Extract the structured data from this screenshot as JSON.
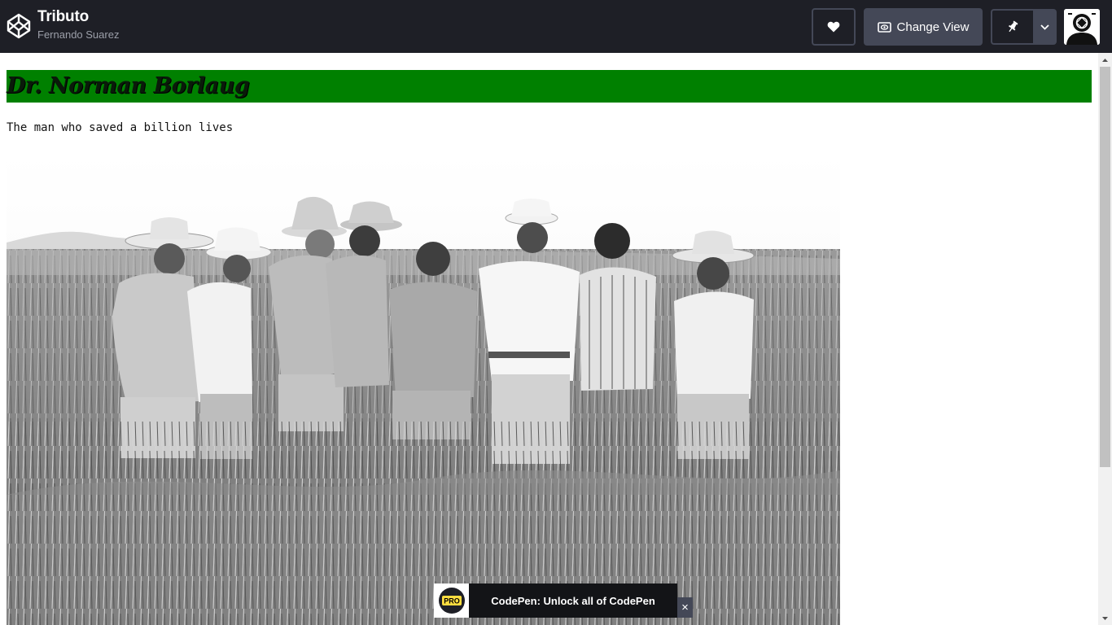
{
  "header": {
    "pen_title": "Tributo",
    "author": "Fernando Suarez",
    "change_view_label": "Change View",
    "icons": {
      "logo": "codepen-logo-icon",
      "heart": "heart-icon",
      "eye": "eye-icon",
      "pin": "pin-icon",
      "caret": "chevron-down-icon",
      "avatar": "user-avatar"
    }
  },
  "preview": {
    "heading": "Dr. Norman Borlaug",
    "subtitle": "The man who saved a billion lives",
    "banner_color": "#008000"
  },
  "promo": {
    "badge": "PRO",
    "text": "CodePen: Unlock all of CodePen",
    "close_label": "×"
  },
  "colors": {
    "topbar_bg": "#1e1f26",
    "button_bg": "#444857",
    "accent_pro": "#ffdd40"
  }
}
